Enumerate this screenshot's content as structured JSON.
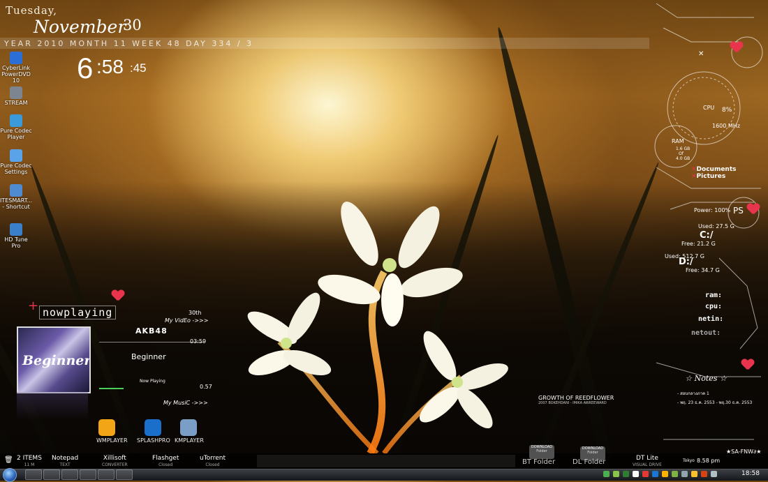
{
  "date": {
    "weekday": "Tuesday,",
    "month": "November",
    "day": "30",
    "infobar": "YEAR 2010   MONTH 11   WEEK 48   DAY 334 / 3"
  },
  "clock": {
    "hour": "6",
    "minute": ":58",
    "second": ":45"
  },
  "desktop_icons": [
    {
      "label": "CyberLink PowerDVD 10",
      "icon": "powerdvd-icon",
      "color": "#2b6fd6"
    },
    {
      "label": "STREAM",
      "icon": "stream-icon",
      "color": "#7d8590"
    },
    {
      "label": "Pure Codec Player",
      "icon": "codec-player-icon",
      "color": "#3b9ad9"
    },
    {
      "label": "Pure Codec Settings",
      "icon": "codec-settings-icon",
      "color": "#5aa3e8"
    },
    {
      "label": "ITESMART... - Shortcut",
      "icon": "shortcut-icon",
      "color": "#4f8bd0"
    },
    {
      "label": "HD Tune Pro",
      "icon": "hdtune-icon",
      "color": "#3a7fc9"
    }
  ],
  "system": {
    "cpu_label": "CPU",
    "cpu_value": "8%",
    "cpu_freq": "1600 MHz",
    "ram_label": "RAM",
    "ram_used": "1.6 GB",
    "ram_of": "Of",
    "ram_total": "4.0 GB",
    "documents": "Documents",
    "pictures": "Pictures",
    "power": "Power: 100%",
    "ps": "PS",
    "c_used": "Used: 27.5 G",
    "c_label": "C:/",
    "c_free": "Free: 21.2 G",
    "d_used": "Used: 512.7 G",
    "d_label": "D:/",
    "d_free": "Free: 34.7 G",
    "meters": [
      "ram:",
      "cpu:",
      "netin:",
      "netout:"
    ]
  },
  "notes": {
    "title": "Notes",
    "line1": "- สอบกลางภาค 1",
    "line2": "- พฤ. 23 ธ.ค. 2553 - พฤ.30 ธ.ค. 2553"
  },
  "signature": "★SA-FNW∂★",
  "now_playing": {
    "title": "nowplaying",
    "date": "30th",
    "my_video": "My VidEo ->>>",
    "artist": "AKB48",
    "time": "03:59",
    "song": "Beginner",
    "status": "Now Playing",
    "position": "0.57",
    "my_music": "My MusiC ->>>",
    "album_art_text": "Beginner"
  },
  "players": [
    {
      "label": "WMPLAYER",
      "icon": "wmplayer-icon",
      "color": "#f2a516"
    },
    {
      "label": "SPLASHPRO",
      "icon": "splashpro-icon",
      "color": "#1a6fcb"
    },
    {
      "label": "KMPLAYER",
      "icon": "kmplayer-icon",
      "color": "#7b9ec7"
    }
  ],
  "wallpaper_caption": {
    "title": "GROWTH OF REEDFLOWER",
    "sub": "2007 BOKEHDANI - IMIKA AWKEEWARD"
  },
  "quickbar": {
    "items_count": "2 ITEMS",
    "items_sub": "11 M",
    "apps": [
      {
        "label": "Notepad",
        "sub": "TEXT"
      },
      {
        "label": "Xillisoft",
        "sub": "CONVERTER"
      },
      {
        "label": "Flashget",
        "sub": "Closed"
      },
      {
        "label": "uTorrent",
        "sub": "Closed"
      }
    ],
    "bt_download": "DOWNLOAD",
    "bt_folder_sub": "Folder",
    "bt_folder": "BT Folder",
    "dl_download": "DOWNLOAD",
    "dl_folder_sub": "Folder",
    "dl_folder": "DL Folder",
    "dtlite": "DT Lite",
    "dtlite_sub": "VISUAL DRIVE",
    "tokyo_label": "Tokyo",
    "tokyo_time": "8.58 pm"
  },
  "taskbar": {
    "clock": "18:58"
  }
}
